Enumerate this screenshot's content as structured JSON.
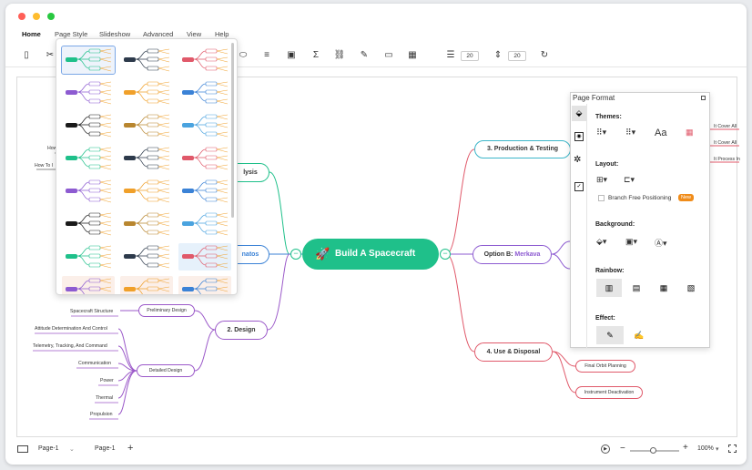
{
  "window": {
    "dots": [
      "#ff5f57",
      "#febc2e",
      "#28c840"
    ]
  },
  "menu": {
    "items": [
      "Home",
      "Page Style",
      "Slideshow",
      "Advanced",
      "View",
      "Help"
    ]
  },
  "toolbar": {
    "line_spacing": "20",
    "text_spacing": "20"
  },
  "mindmap": {
    "central": "Build A Spacecraft",
    "collapse_glyph": "−",
    "right_branches": {
      "production": "3. Production & Testing",
      "option_b_prefix": "Option B: ",
      "option_b_name": "Merkava",
      "use": "4. Use & Disposal"
    },
    "use_children": [
      "Final Orbit Planning",
      "Instrument Deactivation"
    ],
    "right_partial": [
      "It Cover All",
      "It Cover All",
      "It Process In"
    ],
    "left_branches": {
      "analysis_partial": "lysis",
      "option_a_partial": "natos",
      "design": "2. Design"
    },
    "left_partial": [
      "How",
      "How To I"
    ],
    "design_children": [
      "Preliminary Design",
      "Detailed Design"
    ],
    "preliminary_children": [
      "Spacecraft Structure"
    ],
    "detailed_children": [
      "Attitude Determination And Control",
      "Telemetry, Tracking, And Command",
      "Communication",
      "Power",
      "Thermal",
      "Propulsion"
    ]
  },
  "page_format": {
    "title": "Page Format",
    "themes_label": "Themes:",
    "layout_label": "Layout:",
    "branch_free": "Branch Free Positioning",
    "new_badge": "New",
    "background_label": "Background:",
    "rainbow_label": "Rainbow:",
    "effect_label": "Effect:",
    "font_glyph": "Aa"
  },
  "status": {
    "page_select": "Page-1",
    "page_tab": "Page-1",
    "add": "+",
    "zoom": "100%",
    "zoom_minus": "−",
    "zoom_plus": "+"
  }
}
